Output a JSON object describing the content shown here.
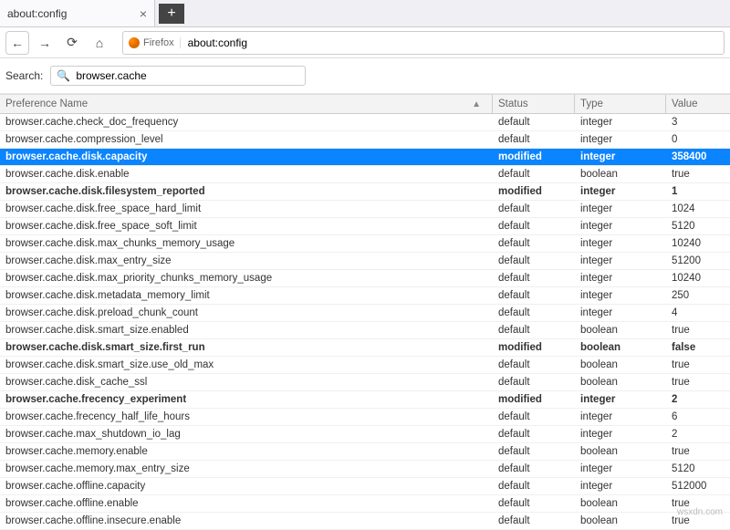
{
  "tab": {
    "title": "about:config"
  },
  "nav": {
    "firefox_label": "Firefox",
    "url": "about:config"
  },
  "search": {
    "label": "Search:",
    "value": "browser.cache"
  },
  "columns": {
    "name": "Preference Name",
    "status": "Status",
    "type": "Type",
    "value": "Value"
  },
  "prefs": [
    {
      "name": "browser.cache.check_doc_frequency",
      "status": "default",
      "type": "integer",
      "value": "3",
      "modified": false,
      "selected": false
    },
    {
      "name": "browser.cache.compression_level",
      "status": "default",
      "type": "integer",
      "value": "0",
      "modified": false,
      "selected": false
    },
    {
      "name": "browser.cache.disk.capacity",
      "status": "modified",
      "type": "integer",
      "value": "358400",
      "modified": true,
      "selected": true
    },
    {
      "name": "browser.cache.disk.enable",
      "status": "default",
      "type": "boolean",
      "value": "true",
      "modified": false,
      "selected": false
    },
    {
      "name": "browser.cache.disk.filesystem_reported",
      "status": "modified",
      "type": "integer",
      "value": "1",
      "modified": true,
      "selected": false
    },
    {
      "name": "browser.cache.disk.free_space_hard_limit",
      "status": "default",
      "type": "integer",
      "value": "1024",
      "modified": false,
      "selected": false
    },
    {
      "name": "browser.cache.disk.free_space_soft_limit",
      "status": "default",
      "type": "integer",
      "value": "5120",
      "modified": false,
      "selected": false
    },
    {
      "name": "browser.cache.disk.max_chunks_memory_usage",
      "status": "default",
      "type": "integer",
      "value": "10240",
      "modified": false,
      "selected": false
    },
    {
      "name": "browser.cache.disk.max_entry_size",
      "status": "default",
      "type": "integer",
      "value": "51200",
      "modified": false,
      "selected": false
    },
    {
      "name": "browser.cache.disk.max_priority_chunks_memory_usage",
      "status": "default",
      "type": "integer",
      "value": "10240",
      "modified": false,
      "selected": false
    },
    {
      "name": "browser.cache.disk.metadata_memory_limit",
      "status": "default",
      "type": "integer",
      "value": "250",
      "modified": false,
      "selected": false
    },
    {
      "name": "browser.cache.disk.preload_chunk_count",
      "status": "default",
      "type": "integer",
      "value": "4",
      "modified": false,
      "selected": false
    },
    {
      "name": "browser.cache.disk.smart_size.enabled",
      "status": "default",
      "type": "boolean",
      "value": "true",
      "modified": false,
      "selected": false
    },
    {
      "name": "browser.cache.disk.smart_size.first_run",
      "status": "modified",
      "type": "boolean",
      "value": "false",
      "modified": true,
      "selected": false
    },
    {
      "name": "browser.cache.disk.smart_size.use_old_max",
      "status": "default",
      "type": "boolean",
      "value": "true",
      "modified": false,
      "selected": false
    },
    {
      "name": "browser.cache.disk_cache_ssl",
      "status": "default",
      "type": "boolean",
      "value": "true",
      "modified": false,
      "selected": false
    },
    {
      "name": "browser.cache.frecency_experiment",
      "status": "modified",
      "type": "integer",
      "value": "2",
      "modified": true,
      "selected": false
    },
    {
      "name": "browser.cache.frecency_half_life_hours",
      "status": "default",
      "type": "integer",
      "value": "6",
      "modified": false,
      "selected": false
    },
    {
      "name": "browser.cache.max_shutdown_io_lag",
      "status": "default",
      "type": "integer",
      "value": "2",
      "modified": false,
      "selected": false
    },
    {
      "name": "browser.cache.memory.enable",
      "status": "default",
      "type": "boolean",
      "value": "true",
      "modified": false,
      "selected": false
    },
    {
      "name": "browser.cache.memory.max_entry_size",
      "status": "default",
      "type": "integer",
      "value": "5120",
      "modified": false,
      "selected": false
    },
    {
      "name": "browser.cache.offline.capacity",
      "status": "default",
      "type": "integer",
      "value": "512000",
      "modified": false,
      "selected": false
    },
    {
      "name": "browser.cache.offline.enable",
      "status": "default",
      "type": "boolean",
      "value": "true",
      "modified": false,
      "selected": false
    },
    {
      "name": "browser.cache.offline.insecure.enable",
      "status": "default",
      "type": "boolean",
      "value": "true",
      "modified": false,
      "selected": false
    }
  ],
  "watermark": "wsxdn.com"
}
